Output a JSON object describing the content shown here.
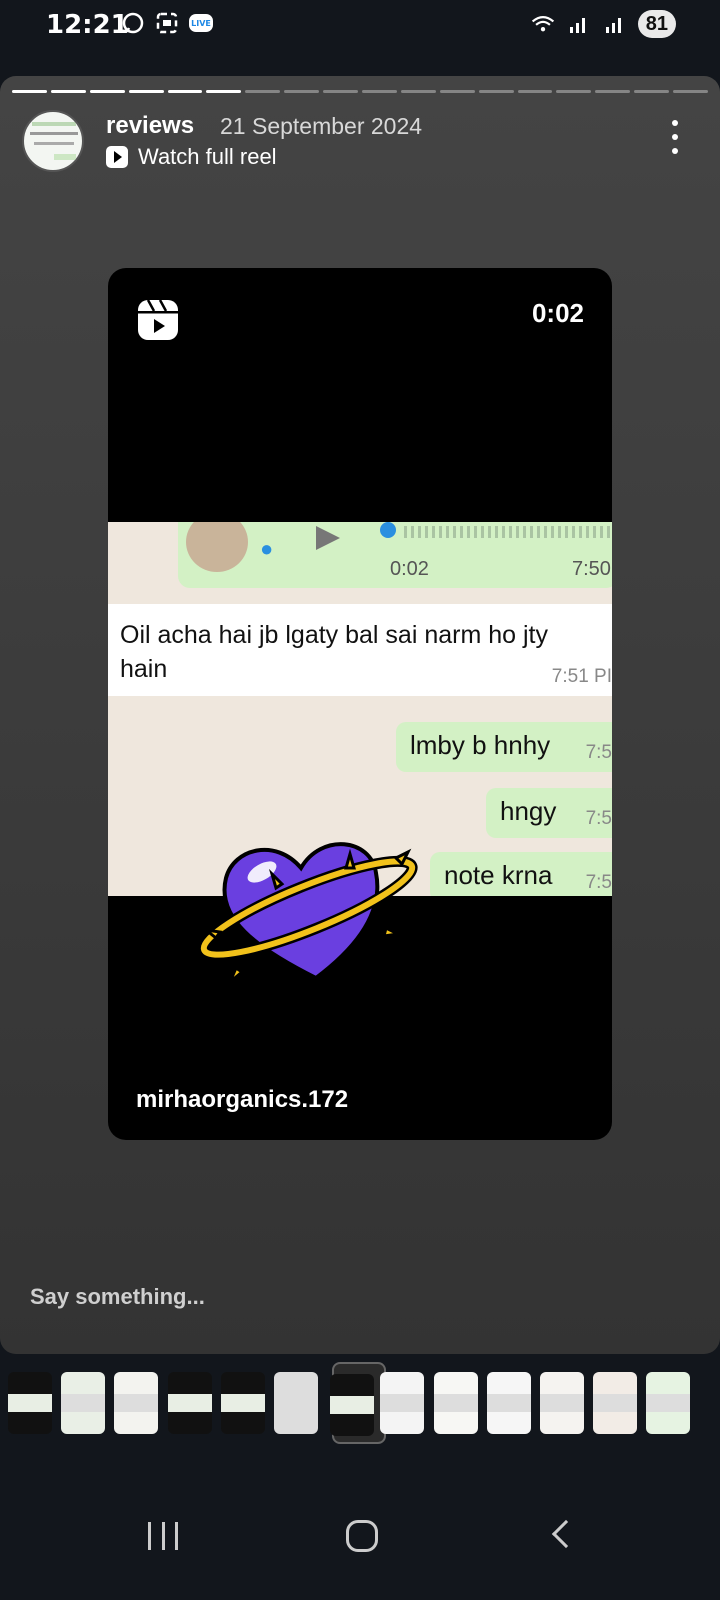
{
  "status_bar": {
    "time": "12:21",
    "left_icons": [
      "whatsapp-icon",
      "screenshot-icon",
      "live-icon"
    ],
    "right_icons": [
      "wifi-icon",
      "signal-icon",
      "signal-icon"
    ],
    "battery": "81"
  },
  "story": {
    "progress_total": 18,
    "progress_done": 6,
    "username": "reviews",
    "date": "21 September 2024",
    "watch_label": "Watch full reel",
    "reel": {
      "duration": "0:02",
      "handle": "mirhaorganics.172",
      "chat": {
        "voice_note": {
          "duration": "0:02",
          "time": "7:50"
        },
        "incoming": {
          "text": "Oil acha hai jb lgaty bal sai narm ho jty hain",
          "time": "7:51 PI"
        },
        "outgoing": [
          {
            "text": "lmby b hnhy",
            "time": "7:5"
          },
          {
            "text": "hngy",
            "time": "7:5"
          },
          {
            "text": "note krna",
            "time": "7:5"
          }
        ]
      }
    },
    "reply_placeholder": "Say something..."
  },
  "thumbnails": {
    "count": 13,
    "active_index": 6,
    "colors": [
      "#111",
      "#e9efe6",
      "#f3f3ef",
      "#111",
      "#111",
      "#ddd",
      "#111",
      "#f4f4f4",
      "#f7f7f4",
      "#f6f6f6",
      "#f5f3f0",
      "#f2ece6",
      "#e6f3e2"
    ]
  },
  "colors": {
    "heart": "#6a3fe0",
    "ring": "#f2c21b",
    "chat_green": "#d3f1c5"
  }
}
